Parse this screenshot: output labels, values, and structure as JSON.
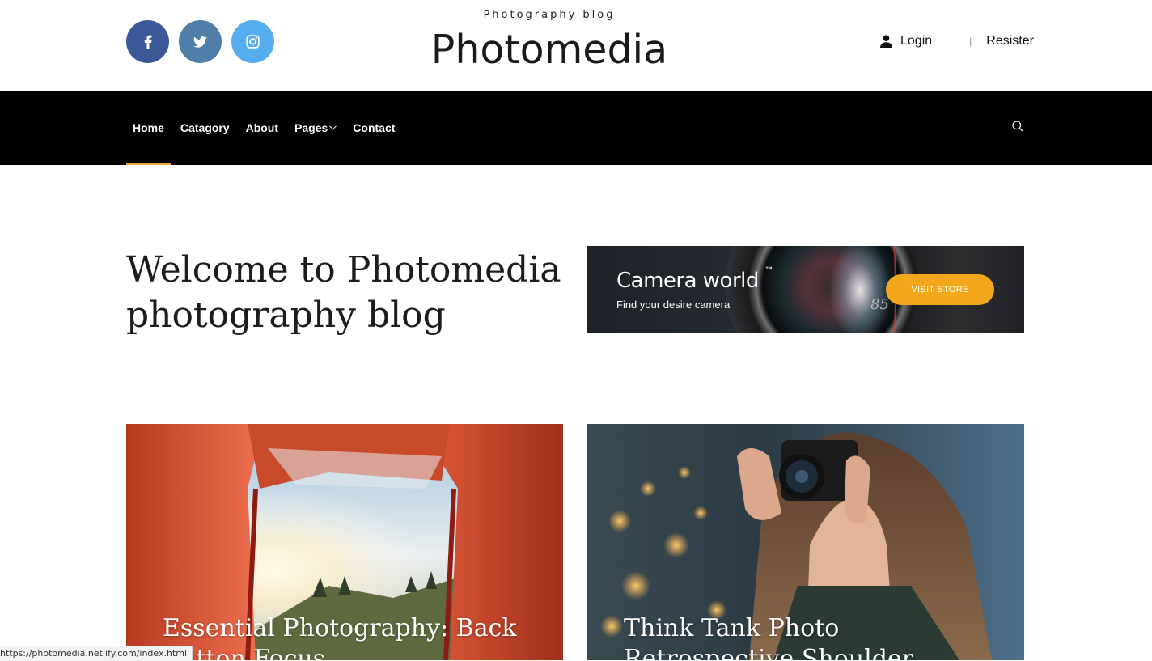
{
  "header": {
    "tagline": "Photography blog",
    "logo": "Photomedia",
    "social": [
      {
        "name": "facebook",
        "icon": "facebook-icon",
        "color": "#3b5998"
      },
      {
        "name": "twitter",
        "icon": "twitter-icon",
        "color": "#4f7ea9"
      },
      {
        "name": "instagram",
        "icon": "instagram-icon",
        "color": "#55acee"
      }
    ],
    "auth": {
      "login": "Login",
      "separator": "|",
      "register": "Resister"
    }
  },
  "nav": {
    "items": [
      {
        "label": "Home",
        "active": true
      },
      {
        "label": "Catagory"
      },
      {
        "label": "About"
      },
      {
        "label": "Pages",
        "dropdown": true
      },
      {
        "label": "Contact"
      }
    ],
    "accent": "#e8a93a",
    "search_icon": "search-icon"
  },
  "welcome": {
    "line1": "Welcome to Photomedia",
    "line2": "photography blog"
  },
  "banner": {
    "title": "Camera world",
    "trademark": "™",
    "subtitle": "Find your desire camera",
    "lens_number": "85",
    "button": "VISIT STORE",
    "button_color": "#f2a81a"
  },
  "posts": [
    {
      "title": "Essential Photography: Back Button Focus"
    },
    {
      "title": "Think Tank Photo Retrospective Shoulder"
    }
  ],
  "statusbar": {
    "url": "https://photomedia.netlify.com/index.html"
  }
}
